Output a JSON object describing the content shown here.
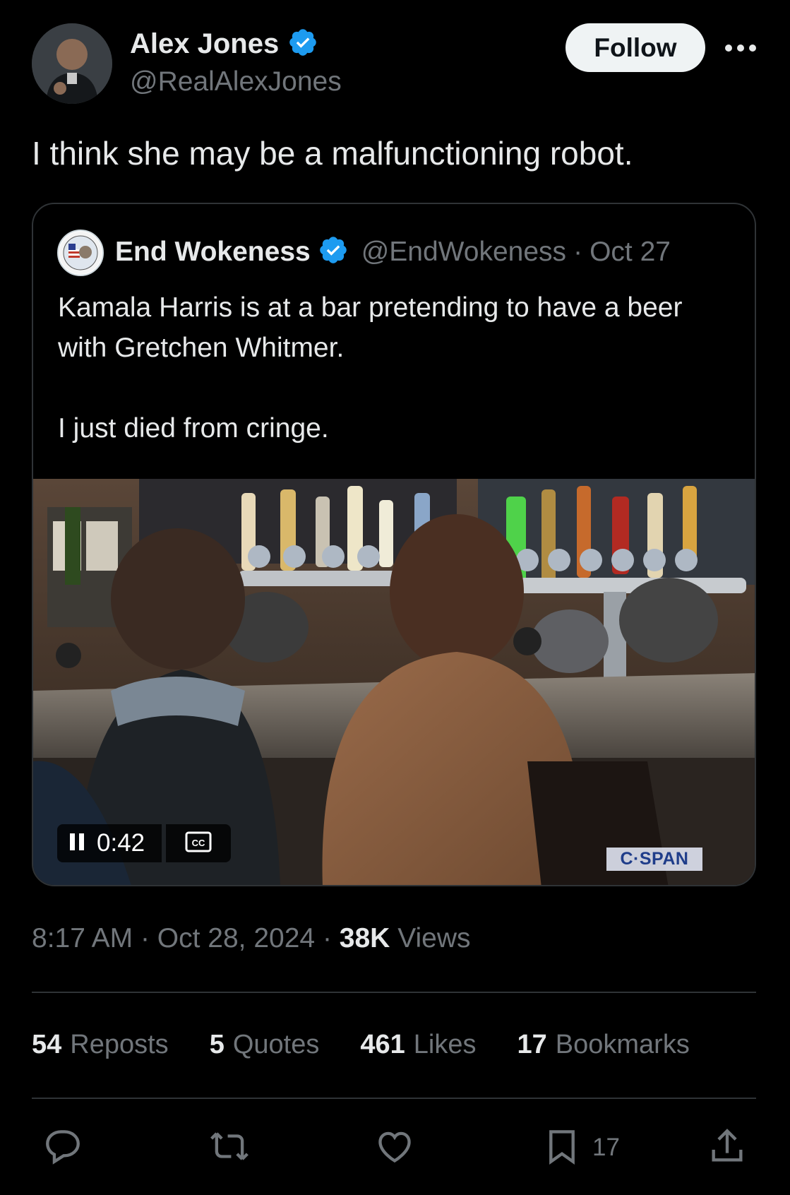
{
  "author": {
    "name": "Alex Jones",
    "handle": "@RealAlexJones",
    "verified": true,
    "follow_label": "Follow"
  },
  "tweet": {
    "text": "I think she may be a malfunctioning robot."
  },
  "quoted": {
    "name": "End Wokeness",
    "handle": "@EndWokeness",
    "separator": "·",
    "date": "Oct 27",
    "lines": [
      "Kamala Harris is at a bar pretending to have a beer with Gretchen Whitmer.",
      "",
      "I just died from cringe."
    ],
    "video": {
      "time": "0:42",
      "watermark": "C·SPAN"
    }
  },
  "meta": {
    "time": "8:17 AM",
    "date": "Oct 28, 2024",
    "dot": "·",
    "views_count": "38K",
    "views_label": "Views"
  },
  "stats": [
    {
      "count": "54",
      "label": "Reposts"
    },
    {
      "count": "5",
      "label": "Quotes"
    },
    {
      "count": "461",
      "label": "Likes"
    },
    {
      "count": "17",
      "label": "Bookmarks"
    }
  ],
  "actions": {
    "reply": "reply-icon",
    "repost": "repost-icon",
    "like": "heart-icon",
    "bookmark": "bookmark-icon",
    "bookmark_count": "17",
    "share": "share-icon"
  },
  "colors": {
    "background": "#000000",
    "text": "#e7e9ea",
    "secondary": "#71767b",
    "verified": "#1d9bf0",
    "border": "#2f3336"
  }
}
